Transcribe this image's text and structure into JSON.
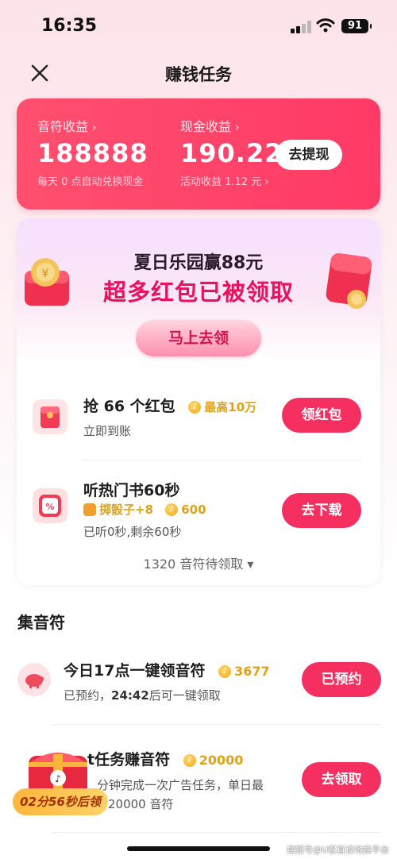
{
  "status_bar": {
    "time": "16:35",
    "battery": "91"
  },
  "nav": {
    "title": "赚钱任务"
  },
  "earnings": {
    "note_label": "音符收益",
    "note_value": "188888",
    "note_hint": "每天 0 点自动兑换现金",
    "cash_label": "现金收益",
    "cash_value": "190.22",
    "cash_hint": "活动收益 1.12 元 ›",
    "withdraw": "去提现"
  },
  "promo": {
    "title": "夏日乐园赢88元",
    "subtitle": "超多红包已被领取",
    "button": "马上去领"
  },
  "tasks": [
    {
      "title": "抢 66 个红包",
      "reward": "最高10万",
      "sub": "立即到账",
      "button": "领红包"
    },
    {
      "title": "听热门书60秒",
      "extra": "掷骰子+8",
      "reward": "600",
      "sub": "已听0秒,剩余60秒",
      "button": "去下载"
    }
  ],
  "pending": "1320 音符待领取 ▾",
  "section": {
    "title": "集音符"
  },
  "list": [
    {
      "title": "今日17点一键领音符",
      "reward": "3677",
      "sub_prefix": "已预约，",
      "sub_time": "24:42",
      "sub_suffix": "后可一键领取",
      "button": "已预约"
    },
    {
      "title": "t任务赚音符",
      "reward": "20000",
      "sub1": "分钟完成一次广告任务，单日最",
      "sub2": "20000 音符",
      "button": "去领取"
    }
  ],
  "floating": {
    "timer": "02分56秒后领"
  },
  "watermark": "搜狐号@U客直谈地推平台",
  "colors": {
    "accent": "#f53060",
    "card": "#ff4f6f",
    "gold": "#e3a214"
  }
}
